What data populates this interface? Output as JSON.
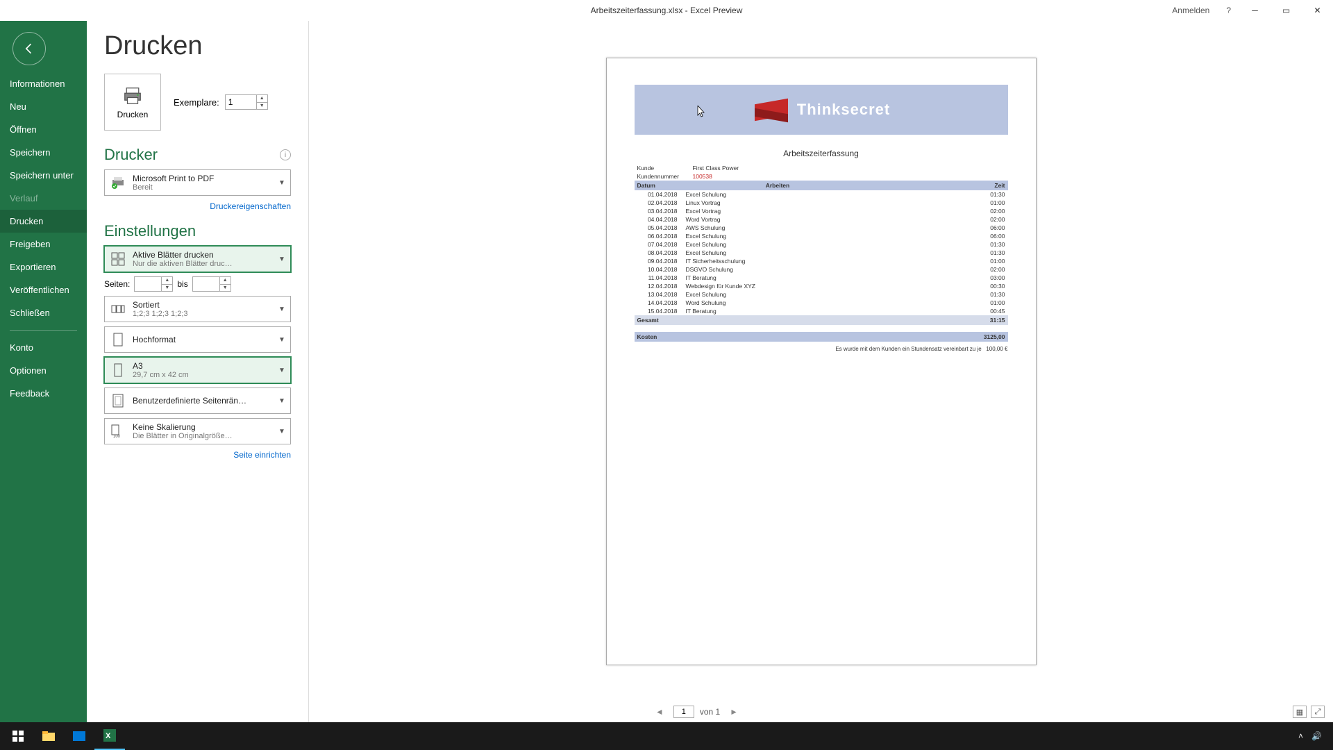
{
  "titlebar": {
    "filename": "Arbeitszeiterfassung.xlsx  -  Excel Preview",
    "signin": "Anmelden",
    "help": "?"
  },
  "sidebar": {
    "items": [
      {
        "label": "Informationen"
      },
      {
        "label": "Neu"
      },
      {
        "label": "Öffnen"
      },
      {
        "label": "Speichern"
      },
      {
        "label": "Speichern unter"
      },
      {
        "label": "Verlauf",
        "disabled": true
      },
      {
        "label": "Drucken",
        "active": true
      },
      {
        "label": "Freigeben"
      },
      {
        "label": "Exportieren"
      },
      {
        "label": "Veröffentlichen"
      },
      {
        "label": "Schließen"
      }
    ],
    "bottom": [
      {
        "label": "Konto"
      },
      {
        "label": "Optionen"
      },
      {
        "label": "Feedback"
      }
    ]
  },
  "panel": {
    "title": "Drucken",
    "print_label": "Drucken",
    "copies_label": "Exemplare:",
    "copies_value": "1",
    "printer_heading": "Drucker",
    "printer": {
      "name": "Microsoft Print to PDF",
      "status": "Bereit"
    },
    "printer_props": "Druckereigenschaften",
    "settings_heading": "Einstellungen",
    "dd_sheets": {
      "title": "Aktive Blätter drucken",
      "sub": "Nur die aktiven Blätter druc…"
    },
    "pages_label": "Seiten:",
    "pages_to": "bis",
    "dd_collate": {
      "title": "Sortiert",
      "sub": "1;2;3    1;2;3    1;2;3"
    },
    "dd_orient": {
      "title": "Hochformat"
    },
    "dd_paper": {
      "title": "A3",
      "sub": "29,7 cm x 42 cm"
    },
    "dd_margin": {
      "title": "Benutzerdefinierte Seitenrän…"
    },
    "dd_scale": {
      "title": "Keine Skalierung",
      "sub": "Die Blätter in Originalgröße…"
    },
    "page_setup": "Seite einrichten"
  },
  "preview": {
    "brand": "Thinksecret",
    "doc_title": "Arbeitszeiterfassung",
    "kunde_label": "Kunde",
    "kunde": "First Class Power",
    "kundennr_label": "Kundennummer",
    "kundennr": "100538",
    "col_datum": "Datum",
    "col_arbeiten": "Arbeiten",
    "col_zeit": "Zeit",
    "rows": [
      {
        "d": "01.04.2018",
        "a": "Excel Schulung",
        "z": "01:30"
      },
      {
        "d": "02.04.2018",
        "a": "Linux Vortrag",
        "z": "01:00"
      },
      {
        "d": "03.04.2018",
        "a": "Excel Vortrag",
        "z": "02:00"
      },
      {
        "d": "04.04.2018",
        "a": "Word Vortrag",
        "z": "02:00"
      },
      {
        "d": "05.04.2018",
        "a": "AWS Schulung",
        "z": "06:00"
      },
      {
        "d": "06.04.2018",
        "a": "Excel Schulung",
        "z": "06:00"
      },
      {
        "d": "07.04.2018",
        "a": "Excel Schulung",
        "z": "01:30"
      },
      {
        "d": "08.04.2018",
        "a": "Excel Schulung",
        "z": "01:30"
      },
      {
        "d": "09.04.2018",
        "a": "IT Sicherheitsschulung",
        "z": "01:00"
      },
      {
        "d": "10.04.2018",
        "a": "DSGVO Schulung",
        "z": "02:00"
      },
      {
        "d": "11.04.2018",
        "a": "IT Beratung",
        "z": "03:00"
      },
      {
        "d": "12.04.2018",
        "a": "Webdesign für Kunde XYZ",
        "z": "00:30"
      },
      {
        "d": "13.04.2018",
        "a": "Excel Schulung",
        "z": "01:30"
      },
      {
        "d": "14.04.2018",
        "a": "Word Schulung",
        "z": "01:00"
      },
      {
        "d": "15.04.2018",
        "a": "IT Beratung",
        "z": "00:45"
      }
    ],
    "sum_label": "Gesamt",
    "sum": "31:15",
    "cost_label": "Kosten",
    "cost": "3125,00",
    "note": "Es wurde mit dem Kunden ein Stundensatz vereinbart zu je",
    "rate": "100,00 €"
  },
  "footer": {
    "page": "1",
    "of": "von 1"
  }
}
